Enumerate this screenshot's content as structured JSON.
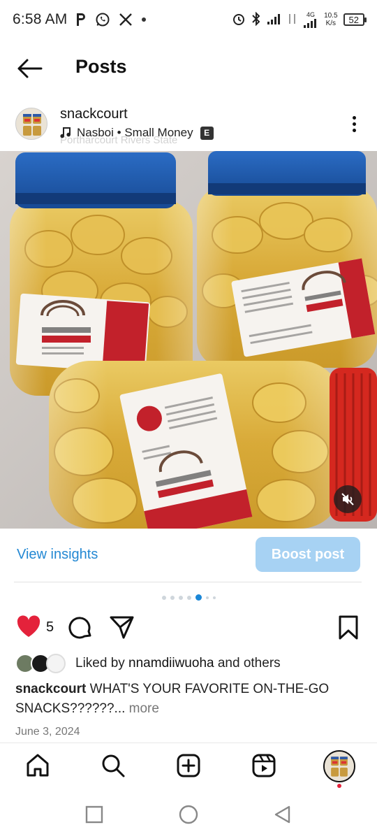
{
  "status_bar": {
    "time": "6:58 AM",
    "network_type": "4G",
    "net_speed_value": "10.5",
    "net_speed_unit": "K/s",
    "battery": "52"
  },
  "header": {
    "title": "Posts"
  },
  "post": {
    "username": "snackcourt",
    "audio": "Nasboi • Small Money",
    "explicit_badge": "E",
    "location": "Portharcourt Rivers State",
    "like_count": "5",
    "liked_by_prefix": "Liked by ",
    "liked_by_user": "nnamdiiwuoha",
    "liked_by_suffix": " and others",
    "caption_user": "snackcourt",
    "caption_text": " WHAT'S YOUR FAVORITE ON-THE-GO SNACKS??????...",
    "caption_more": " more",
    "date": "June 3, 2024",
    "carousel_total": 7,
    "carousel_active": 5
  },
  "insights": {
    "view_label": "View insights",
    "boost_label": "Boost post"
  },
  "colors": {
    "accent_blue": "#2388d3",
    "boost_bg": "#a7d2f3",
    "like_red": "#e4223b"
  },
  "icons": {
    "back": "arrow-left-icon",
    "more": "more-vertical-icon",
    "music": "music-note-icon",
    "mute": "speaker-muted-icon",
    "like": "heart-filled-icon",
    "comment": "comment-bubble-icon",
    "share": "paper-plane-icon",
    "save": "bookmark-icon",
    "home": "home-icon",
    "search": "search-icon",
    "create": "plus-square-icon",
    "reels": "reels-icon"
  }
}
